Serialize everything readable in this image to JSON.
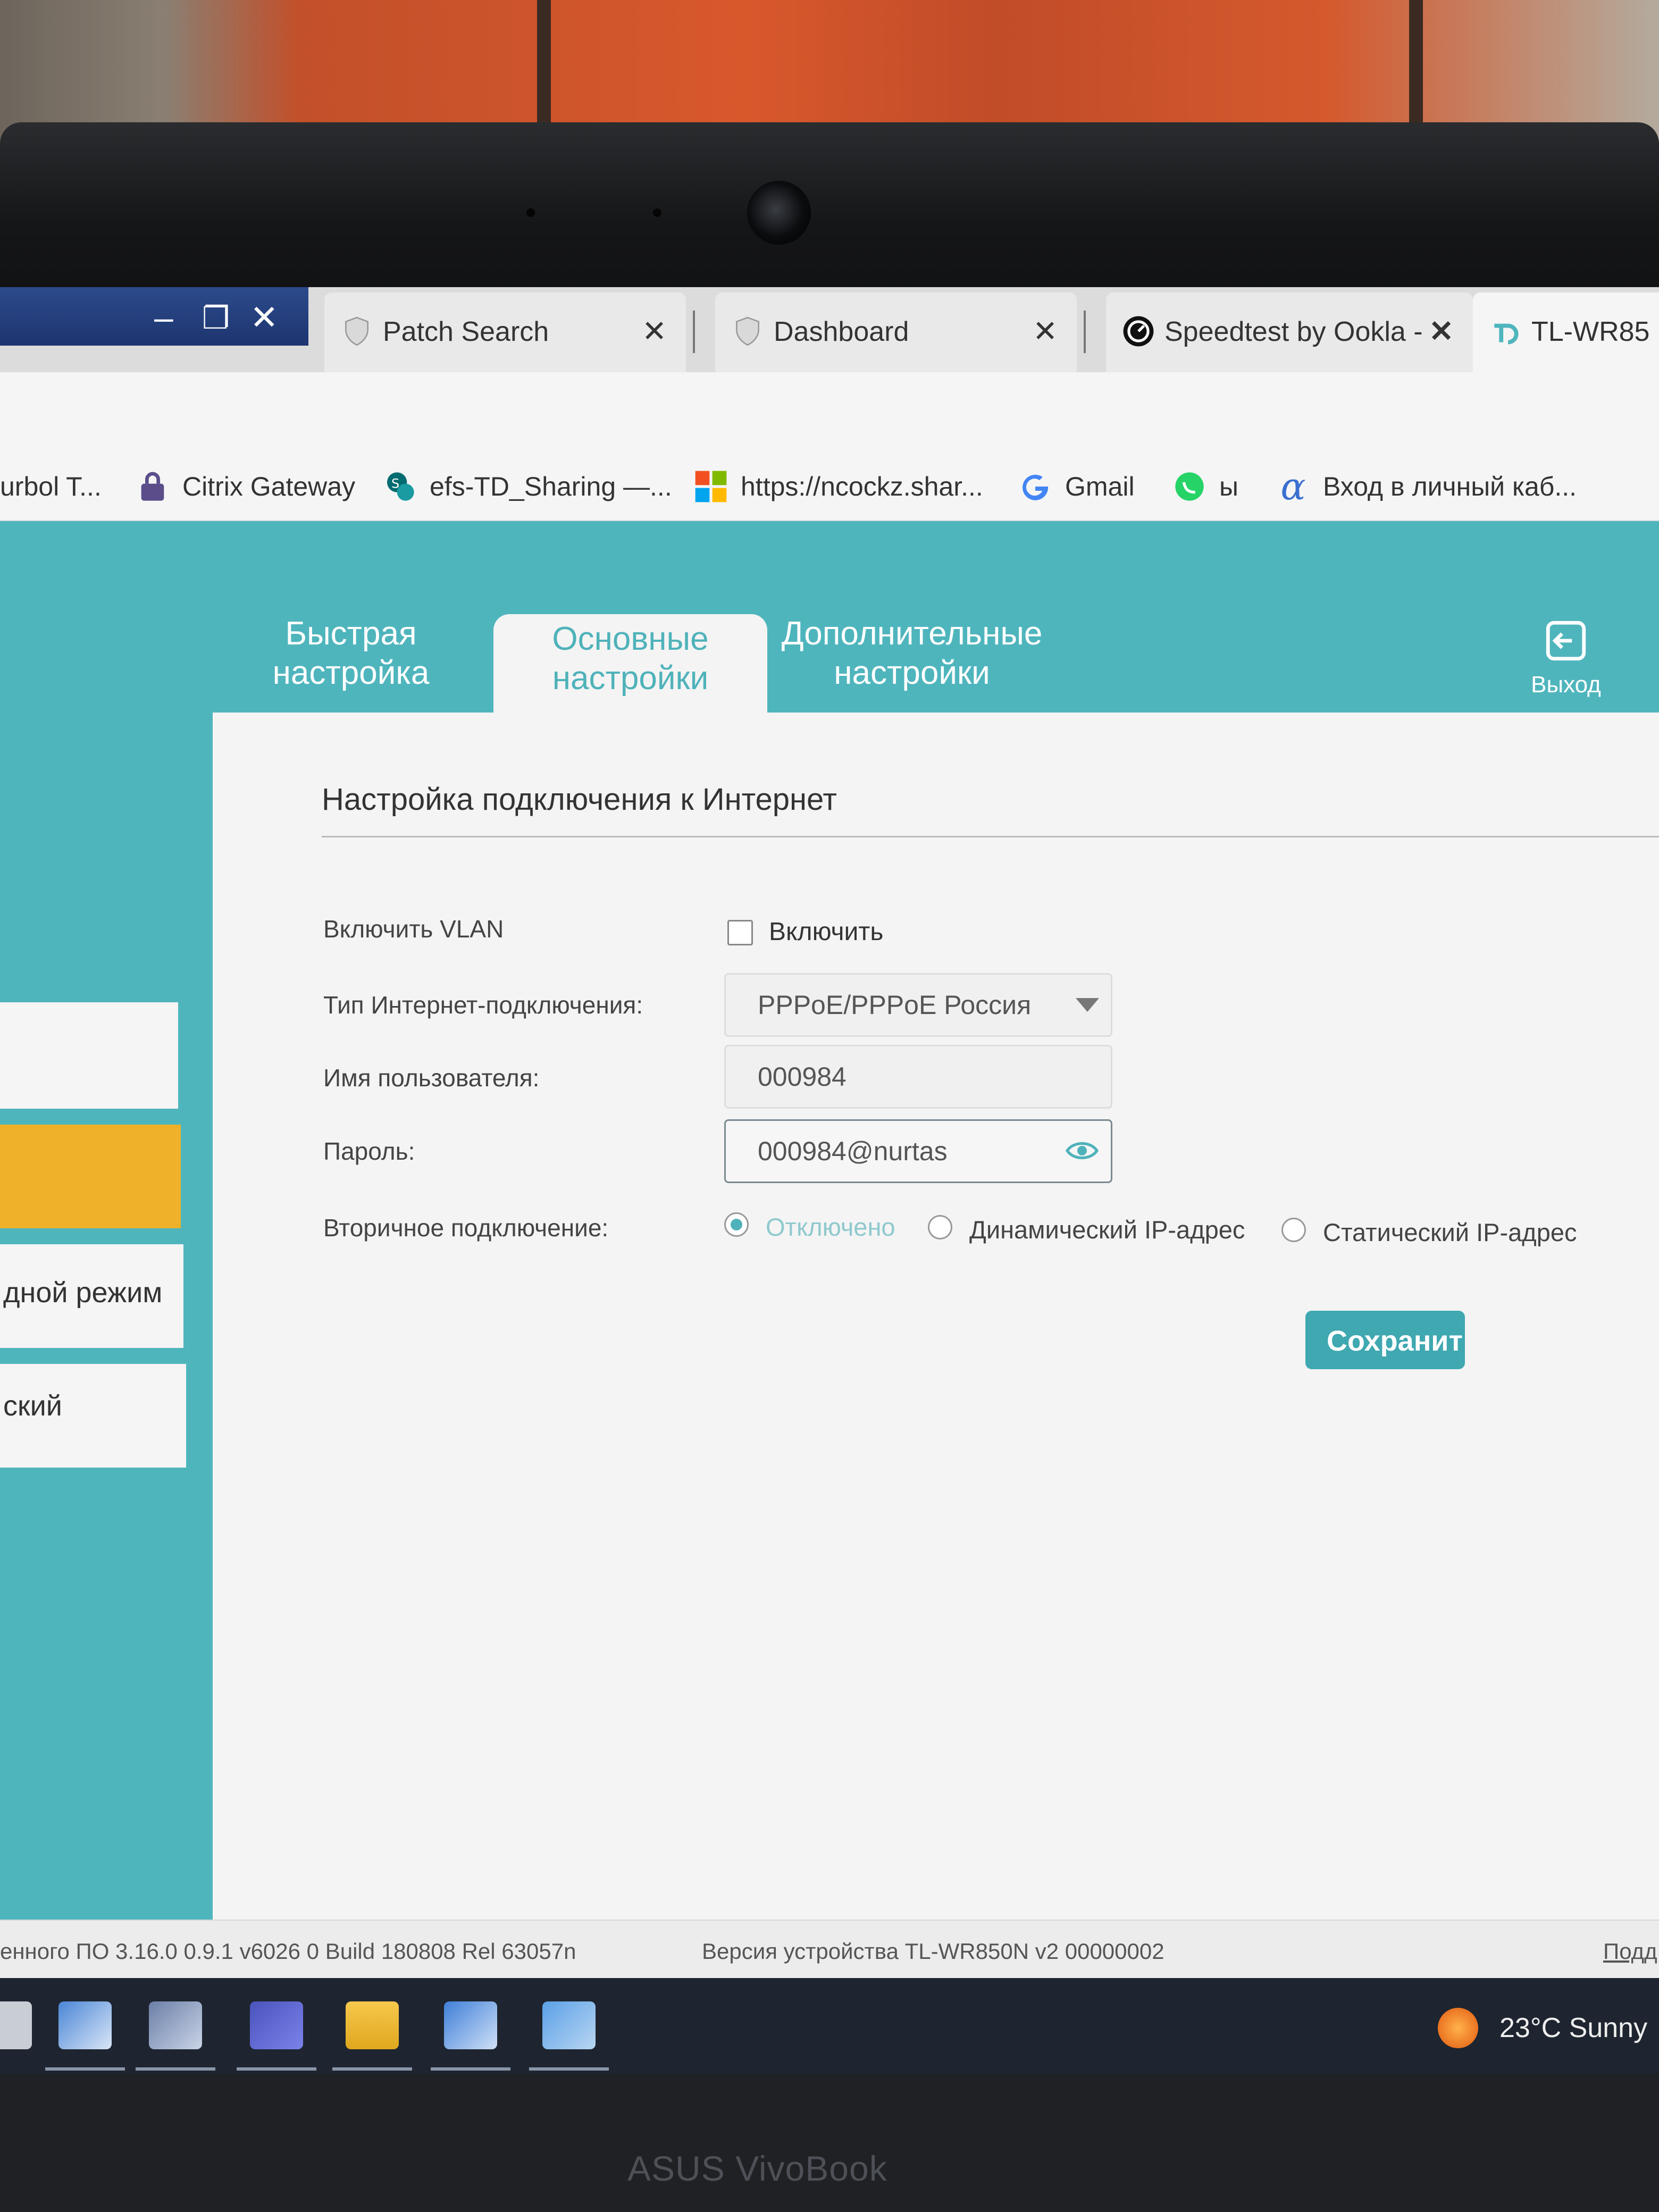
{
  "browser": {
    "tabs": [
      {
        "title": "Patch Search",
        "icon": "shield-icon"
      },
      {
        "title": "Dashboard",
        "icon": "shield-icon"
      },
      {
        "title": "Speedtest by Ookla -",
        "icon": "speedtest-icon"
      },
      {
        "title": "TL-WR85",
        "icon": "tplink-icon"
      }
    ],
    "bookmarks": [
      {
        "label": "urbol T...",
        "icon": "none"
      },
      {
        "label": "Citrix Gateway",
        "icon": "lock-icon"
      },
      {
        "label": "efs-TD_Sharing —...",
        "icon": "sharepoint-icon"
      },
      {
        "label": "https://ncockz.shar...",
        "icon": "microsoft-icon"
      },
      {
        "label": "Gmail",
        "icon": "google-icon"
      },
      {
        "label": "ы",
        "icon": "whatsapp-icon"
      },
      {
        "label": "Вход в личный каб...",
        "icon": "alpha-icon"
      }
    ]
  },
  "router": {
    "nav": {
      "quick_l1": "Быстрая",
      "quick_l2": "настройка",
      "basic_l1": "Основные",
      "basic_l2": "настройки",
      "advanced_l1": "Дополнительные",
      "advanced_l2": "настройки",
      "exit": "Выход"
    },
    "sidebar": {
      "item1": "",
      "item2": "",
      "item3": "дной режим",
      "item4": "ский"
    },
    "section_title": "Настройка подключения к Интернет",
    "form": {
      "vlan_label": "Включить VLAN",
      "vlan_checkbox_label": "Включить",
      "vlan_enabled": false,
      "conn_type_label": "Тип Интернет-подключения:",
      "conn_type_value": "PPPoE/PPPoE Россия",
      "username_label": "Имя пользователя:",
      "username_value": "000984",
      "password_label": "Пароль:",
      "password_value": "000984@nurtas",
      "secondary_label": "Вторичное подключение:",
      "secondary_options": [
        "Отключено",
        "Динамический IP-адрес",
        "Статический IP-адрес"
      ],
      "secondary_selected": "Отключено"
    },
    "save_button": "Сохранит",
    "footer": {
      "firmware": "енного ПО 3.16.0 0.9.1 v6026 0 Build 180808 Rel 63057n",
      "device": "Версия устройства TL-WR850N v2 00000002",
      "support": "Подд"
    }
  },
  "taskbar": {
    "weather": "23°C  Sunny"
  },
  "device_brand": "ASUS VivoBook",
  "colors": {
    "router_teal": "#4fb5bd",
    "accent_button": "#3fa8b1",
    "sidebar_selected": "#f0b12a"
  }
}
